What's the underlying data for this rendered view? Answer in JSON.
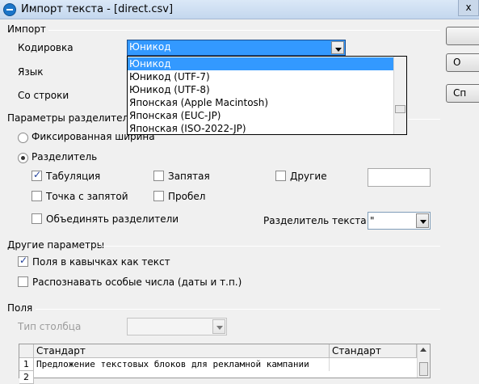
{
  "window": {
    "title": "Импорт текста - [direct.csv]",
    "close_label": "x"
  },
  "import": {
    "section": "Импорт",
    "encoding_label": "Кодировка",
    "encoding_value": "Юникод",
    "language_label": "Язык",
    "from_row_label": "Со строки",
    "encoding_options": [
      "Юникод",
      "Юникод (UTF-7)",
      "Юникод (UTF-8)",
      "Японская (Apple Macintosh)",
      "Японская (EUC-JP)",
      "Японская (ISO-2022-JP)"
    ]
  },
  "separator": {
    "section": "Параметры разделителя",
    "fixed_width_label": "Фиксированная ширина",
    "separated_label": "Разделитель",
    "tab_label": "Табуляция",
    "tab_checked": true,
    "comma_label": "Запятая",
    "comma_checked": false,
    "other_label": "Другие",
    "other_checked": false,
    "other_value": "",
    "semicolon_label": "Точка с запятой",
    "space_label": "Пробел",
    "merge_label": "Объединять разделители",
    "text_delimiter_label": "Разделитель текста",
    "text_delimiter_value": "\""
  },
  "other_options": {
    "section": "Другие параметры",
    "quoted_as_text_label": "Поля в кавычках как текст",
    "quoted_as_text_checked": true,
    "detect_numbers_label": "Распознавать особые числа (даты и т.п.)",
    "detect_numbers_checked": false
  },
  "fields": {
    "section": "Поля",
    "column_type_label": "Тип столбца",
    "column_type_value": "",
    "headers": [
      "Стандарт",
      "Стандарт"
    ],
    "rows": [
      {
        "num": "1",
        "cells": [
          "Предложение текстовых блоков для рекламной кампании",
          ""
        ]
      },
      {
        "num": "2",
        "cells": [
          "",
          ""
        ]
      }
    ]
  },
  "buttons": [
    "",
    "О",
    "Сп"
  ]
}
